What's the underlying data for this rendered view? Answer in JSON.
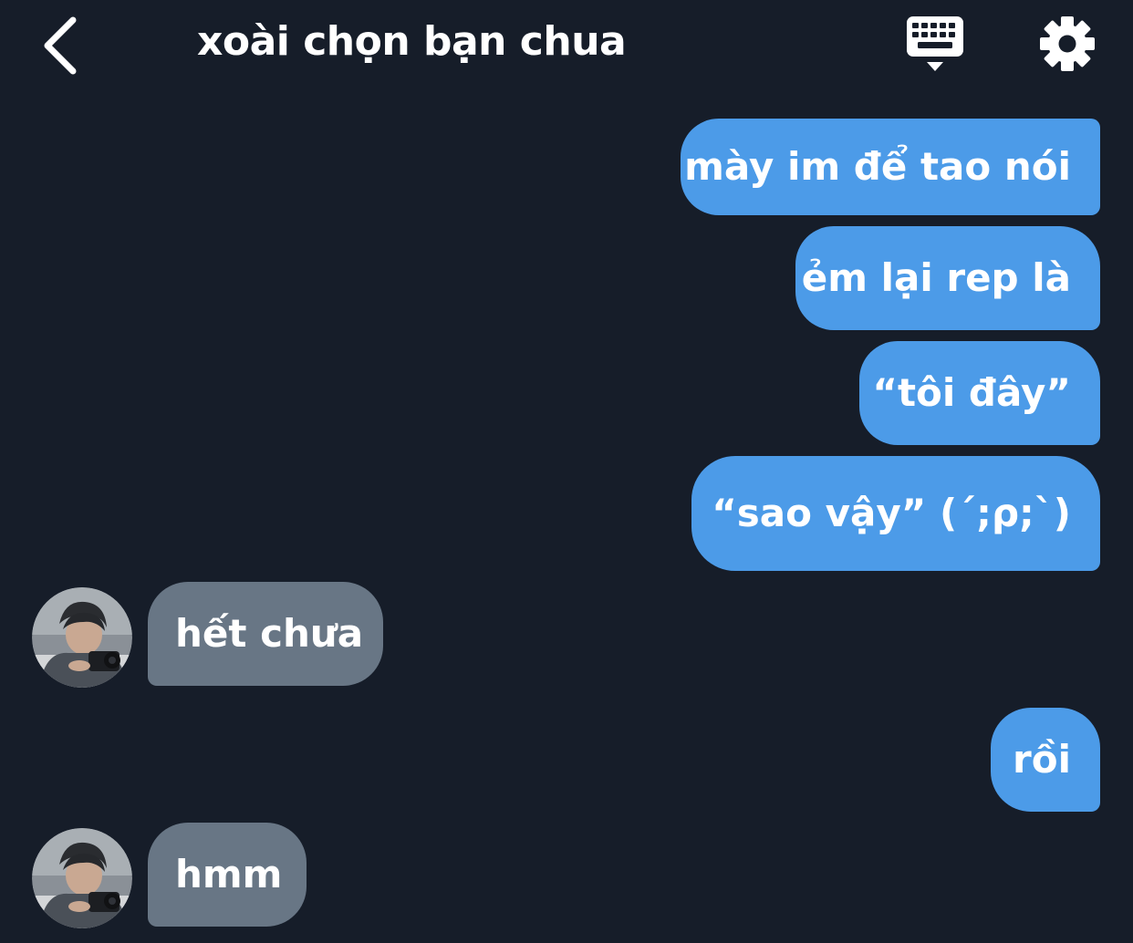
{
  "header": {
    "title": "xoài chọn bạn chua",
    "back_icon": "chevron-left-icon",
    "keyboard_icon": "keyboard-icon",
    "settings_icon": "gear-icon"
  },
  "messages": [
    {
      "sender": "me",
      "text": "mày im để tao nói"
    },
    {
      "sender": "me",
      "text": "ẻm lại rep là"
    },
    {
      "sender": "me",
      "text": "“tôi đây”"
    },
    {
      "sender": "me",
      "text": "“sao vậy” (´;ρ;`)"
    },
    {
      "sender": "other",
      "text": "hết chưa"
    },
    {
      "sender": "me",
      "text": "rồi"
    },
    {
      "sender": "other",
      "text": "hmm"
    }
  ],
  "colors": {
    "background": "#161d29",
    "outgoing_bubble": "#4c9be8",
    "incoming_bubble": "#687685",
    "text": "#ffffff"
  }
}
